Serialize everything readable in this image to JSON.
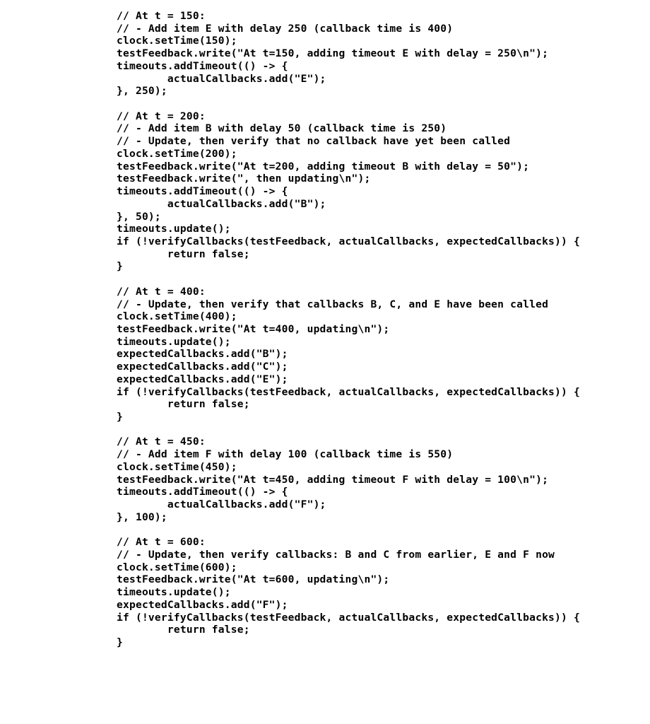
{
  "code": {
    "lines": [
      "// At t = 150:",
      "// - Add item E with delay 250 (callback time is 400)",
      "clock.setTime(150);",
      "testFeedback.write(\"At t=150, adding timeout E with delay = 250\\n\");",
      "timeouts.addTimeout(() -> {",
      "        actualCallbacks.add(\"E\");",
      "}, 250);",
      "",
      "// At t = 200:",
      "// - Add item B with delay 50 (callback time is 250)",
      "// - Update, then verify that no callback have yet been called",
      "clock.setTime(200);",
      "testFeedback.write(\"At t=200, adding timeout B with delay = 50\");",
      "testFeedback.write(\", then updating\\n\");",
      "timeouts.addTimeout(() -> {",
      "        actualCallbacks.add(\"B\");",
      "}, 50);",
      "timeouts.update();",
      "if (!verifyCallbacks(testFeedback, actualCallbacks, expectedCallbacks)) {",
      "        return false;",
      "}",
      "",
      "// At t = 400:",
      "// - Update, then verify that callbacks B, C, and E have been called",
      "clock.setTime(400);",
      "testFeedback.write(\"At t=400, updating\\n\");",
      "timeouts.update();",
      "expectedCallbacks.add(\"B\");",
      "expectedCallbacks.add(\"C\");",
      "expectedCallbacks.add(\"E\");",
      "if (!verifyCallbacks(testFeedback, actualCallbacks, expectedCallbacks)) {",
      "        return false;",
      "}",
      "",
      "// At t = 450:",
      "// - Add item F with delay 100 (callback time is 550)",
      "clock.setTime(450);",
      "testFeedback.write(\"At t=450, adding timeout F with delay = 100\\n\");",
      "timeouts.addTimeout(() -> {",
      "        actualCallbacks.add(\"F\");",
      "}, 100);",
      "",
      "// At t = 600:",
      "// - Update, then verify callbacks: B and C from earlier, E and F now",
      "clock.setTime(600);",
      "testFeedback.write(\"At t=600, updating\\n\");",
      "timeouts.update();",
      "expectedCallbacks.add(\"F\");",
      "if (!verifyCallbacks(testFeedback, actualCallbacks, expectedCallbacks)) {",
      "        return false;",
      "}"
    ]
  }
}
